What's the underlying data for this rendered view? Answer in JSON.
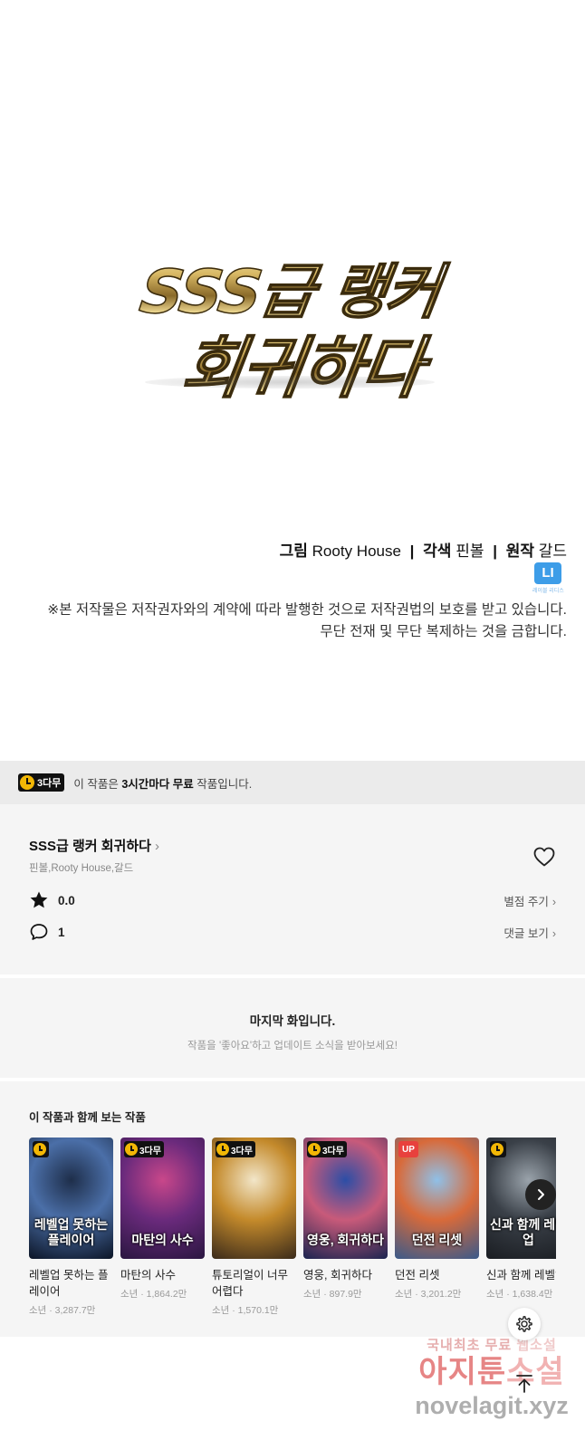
{
  "comic": {
    "logo_line1": "SSS급 랭커",
    "logo_line2": "회귀하다",
    "credits": {
      "art_label": "그림",
      "art_name": "Rooty House",
      "adapt_label": "각색",
      "adapt_name": "핀볼",
      "original_label": "원작",
      "original_name": "갈드",
      "separator": "|"
    },
    "publisher_badge": "LI",
    "publisher_badge_caption": "레이블 리디스",
    "notice_line1": "※본 저작물은 저작권자와의 계약에 따라 발행한 것으로 저작권법의 보호를 받고 있습니다.",
    "notice_line2": "무단 전재 및 무단 복제하는 것을 금합니다."
  },
  "free_banner": {
    "badge": "3다무",
    "text_prefix": "이 작품은 ",
    "text_bold": "3시간마다 무료",
    "text_suffix": " 작품입니다."
  },
  "series": {
    "title": "SSS급 랭커 회귀하다",
    "authors": "핀볼,Rooty House,갈드",
    "rating": "0.0",
    "rate_action": "별점 주기",
    "comment_count": "1",
    "comment_action": "댓글 보기"
  },
  "last_episode": {
    "title": "마지막 화입니다.",
    "subtitle": "작품을 '좋아요'하고 업데이트 소식을 받아보세요!"
  },
  "recommendations": {
    "heading": "이 작품과 함께 보는 작품",
    "items": [
      {
        "badge": "",
        "badge_type": "clock",
        "cover_text": "레벨업 못하는 플레이어",
        "name": "레벨업 못하는 플레이어",
        "meta": "소년 · 3,287.7만",
        "colors": [
          "#1e2e4a",
          "#4b6fa8",
          "#0c1526"
        ]
      },
      {
        "badge": "3다무",
        "badge_type": "wait",
        "cover_text": "마탄의 사수",
        "name": "마탄의 사수",
        "meta": "소년 · 1,864.2만",
        "colors": [
          "#c9478a",
          "#6a2a7c",
          "#2a1640"
        ]
      },
      {
        "badge": "3다무",
        "badge_type": "wait",
        "cover_text": "",
        "name": "튜토리얼이 너무 어렵다",
        "meta": "소년 · 1,570.1만",
        "colors": [
          "#f2e6c9",
          "#c48a2b",
          "#3a2a1a"
        ]
      },
      {
        "badge": "3다무",
        "badge_type": "wait",
        "cover_text": "영웅, 회귀하다",
        "name": "영웅, 회귀하다",
        "meta": "소년 · 897.9만",
        "colors": [
          "#2c4ea6",
          "#c85a7a",
          "#1a2450"
        ]
      },
      {
        "badge": "UP",
        "badge_type": "up",
        "cover_text": "던전 리셋",
        "name": "던전 리셋",
        "meta": "소년 · 3,201.2만",
        "colors": [
          "#8fc0e8",
          "#d86a3a",
          "#3a5a8a"
        ]
      },
      {
        "badge": "",
        "badge_type": "clock",
        "cover_text": "신과 함께 레벨업",
        "name": "신과 함께 레벨업",
        "meta": "소년 · 1,638.4만",
        "colors": [
          "#9aa3ab",
          "#3a4048",
          "#1a1d22"
        ]
      }
    ]
  },
  "watermark": {
    "line1_a": "국내최초 무료",
    "line1_b": "웹소설",
    "line2_a": "아지툰",
    "line2_b": "소설",
    "line3": "novelagit.xyz"
  }
}
